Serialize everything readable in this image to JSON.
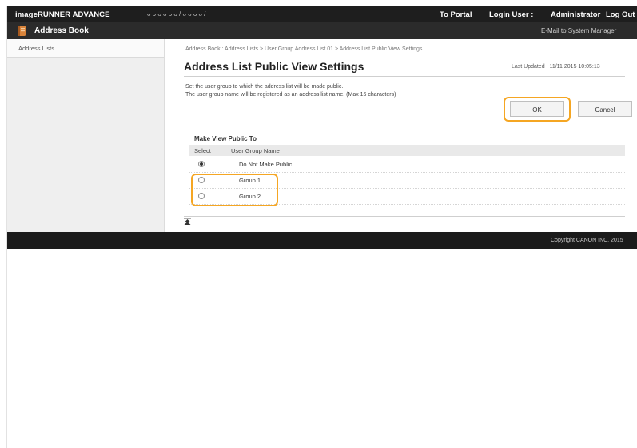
{
  "topbar": {
    "product": "imageRUNNER ADVANCE",
    "device_name": "ᴗ ᴗ ᴗ ᴗ ᴗ ᴗ / ᴗ ᴗ ᴗ ᴗ /",
    "portal_link": "To Portal",
    "login_label": "Login User :",
    "login_user": "Administrator",
    "logout_link": "Log Out"
  },
  "appbar": {
    "title": "Address Book",
    "icon": "address-book-icon",
    "mail_link": "E-Mail to System Manager"
  },
  "sidebar": {
    "items": [
      {
        "label": "Address Lists"
      }
    ]
  },
  "main": {
    "breadcrumb": "Address Book : Address Lists > User Group Address List 01 > Address List Public View Settings",
    "title": "Address List Public View Settings",
    "last_updated": "Last Updated : 11/11 2015 10:05:13",
    "description_line1": "Set the user group to which the address list will be made public.",
    "description_line2": "The user group name will be registered as an address list name. (Max 16 characters)",
    "ok_label": "OK",
    "cancel_label": "Cancel",
    "section_heading": "Make View Public To",
    "table": {
      "headers": {
        "select": "Select",
        "name": "User Group Name"
      },
      "rows": [
        {
          "name": "Do Not Make Public",
          "selected": true
        },
        {
          "name": "Group 1",
          "selected": false
        },
        {
          "name": "Group 2",
          "selected": false
        }
      ]
    },
    "to_top_icon": "to-top-icon"
  },
  "footer": {
    "copyright": "Copyright CANON INC. 2015"
  },
  "colors": {
    "highlight": "#f5a623",
    "topbar": "#1e1e1e",
    "appbar": "#2b2b2b"
  }
}
